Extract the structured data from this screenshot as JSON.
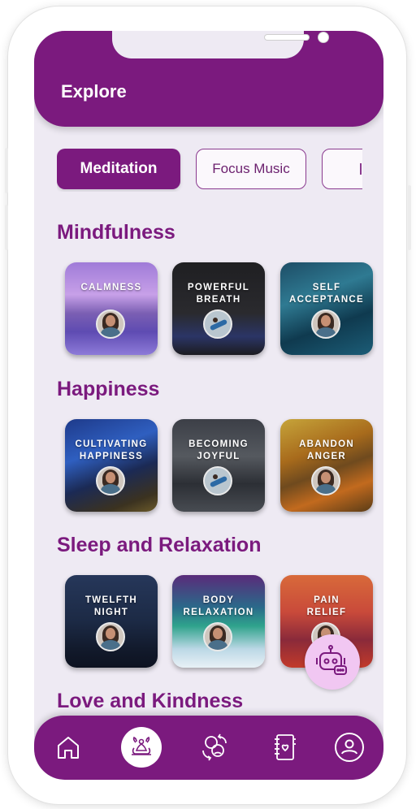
{
  "header": {
    "title": "Explore"
  },
  "tabs": [
    {
      "label": "Meditation",
      "active": true
    },
    {
      "label": "Focus Music",
      "active": false
    },
    {
      "label": "",
      "active": false
    }
  ],
  "sections": [
    {
      "title": "Mindfulness",
      "cards": [
        {
          "label": "CALMNESS",
          "avatar": "person"
        },
        {
          "label": "POWERFUL\nBREATH",
          "avatar": "yoga"
        },
        {
          "label": "SELF\nACCEPTANCE",
          "avatar": "person"
        }
      ]
    },
    {
      "title": "Happiness",
      "cards": [
        {
          "label": "CULTIVATING\nHAPPINESS",
          "avatar": "person"
        },
        {
          "label": "BECOMING\nJOYFUL",
          "avatar": "yoga"
        },
        {
          "label": "ABANDON\nANGER",
          "avatar": "person"
        }
      ]
    },
    {
      "title": "Sleep and Relaxation",
      "cards": [
        {
          "label": "TWELFTH\nNIGHT",
          "avatar": "person"
        },
        {
          "label": "BODY\nRELAXATION",
          "avatar": "person"
        },
        {
          "label": "PAIN\nRELIEF",
          "avatar": "person"
        }
      ]
    },
    {
      "title": "Love and Kindness",
      "cards": []
    }
  ],
  "fab": {
    "icon": "chatbot-icon"
  },
  "nav": [
    {
      "icon": "home-icon",
      "active": false
    },
    {
      "icon": "meditation-lotus-icon",
      "active": true
    },
    {
      "icon": "people-connect-icon",
      "active": false
    },
    {
      "icon": "journal-icon",
      "active": false
    },
    {
      "icon": "profile-icon",
      "active": false
    }
  ],
  "colors": {
    "primary": "#7b1a7e",
    "background": "#eeeaf3",
    "fab": "#f1c7f2"
  }
}
